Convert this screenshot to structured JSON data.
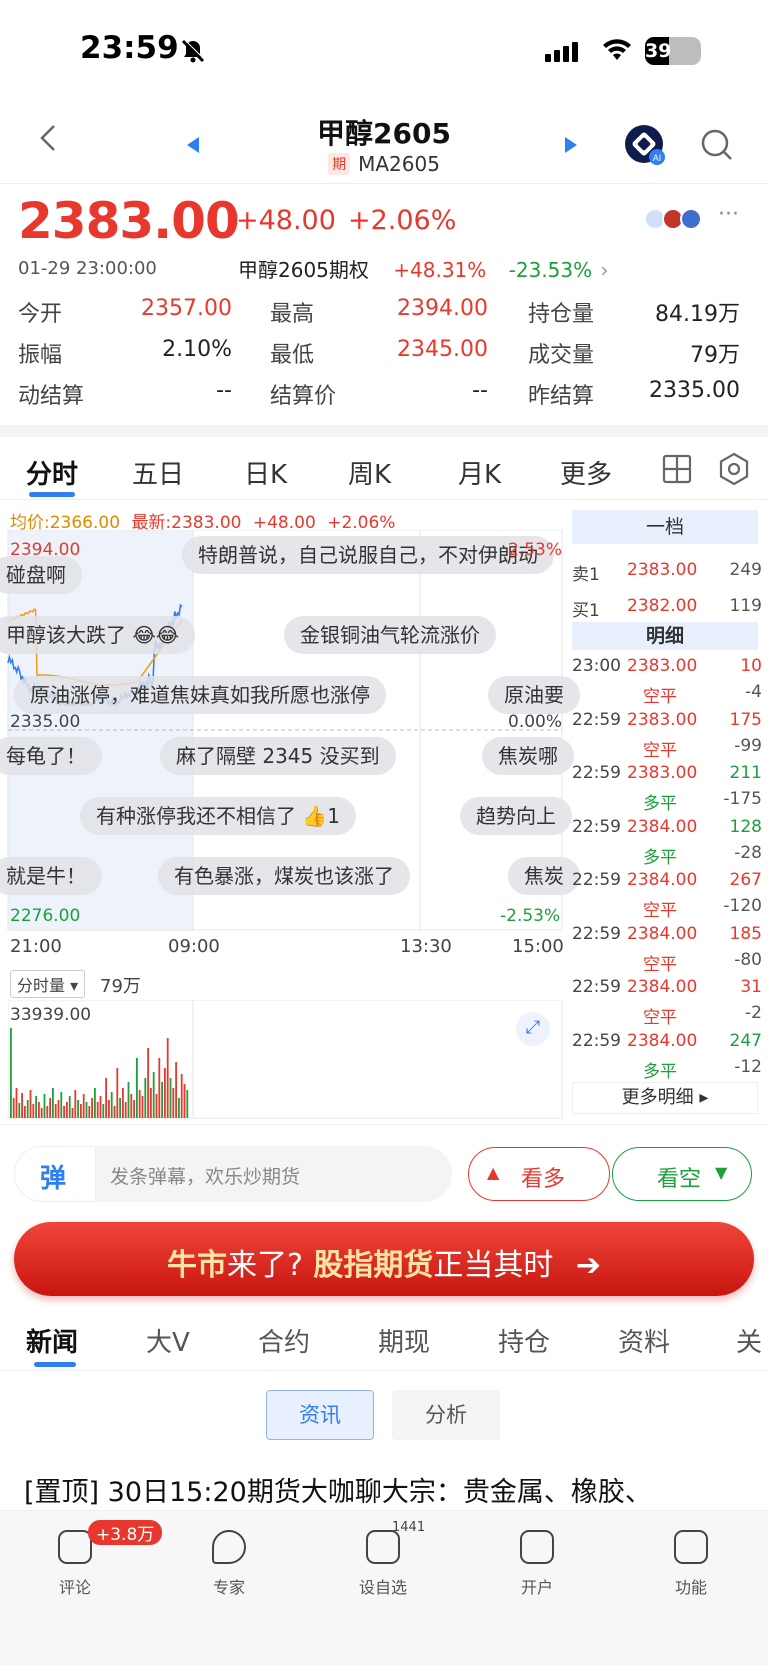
{
  "status": {
    "time": "23:59",
    "battery": "39"
  },
  "header": {
    "title": "甲醇2605",
    "badge": "期",
    "code": "MA2605"
  },
  "quote": {
    "price": "2383.00",
    "change": "+48.00",
    "pct": "+2.06%",
    "datetime": "01-29 23:00:00",
    "option_name": "甲醇2605期权",
    "option_up": "+48.31%",
    "option_down": "-23.53%"
  },
  "stats": [
    {
      "label": "今开",
      "value": "2357.00",
      "color": "red"
    },
    {
      "label": "最高",
      "value": "2394.00",
      "color": "red"
    },
    {
      "label": "持仓量",
      "value": "84.19万",
      "color": "black"
    },
    {
      "label": "振幅",
      "value": "2.10%",
      "color": "black"
    },
    {
      "label": "最低",
      "value": "2345.00",
      "color": "red"
    },
    {
      "label": "成交量",
      "value": "79万",
      "color": "black"
    },
    {
      "label": "动结算",
      "value": "--",
      "color": "black"
    },
    {
      "label": "结算价",
      "value": "--",
      "color": "black"
    },
    {
      "label": "昨结算",
      "value": "2335.00",
      "color": "black"
    }
  ],
  "tabs": [
    "分时",
    "五日",
    "日K",
    "周K",
    "月K",
    "更多"
  ],
  "legend": {
    "avg": "均价:2366.00",
    "latest": "最新:2383.00",
    "change": "+48.00",
    "pct": "+2.06%"
  },
  "chart_data": {
    "type": "line",
    "xticks": [
      "21:00",
      "09:00",
      "13:30",
      "15:00"
    ],
    "yticks_left": [
      "2394.00",
      "2335.00",
      "2276.00"
    ],
    "yticks_right": [
      "2.53%",
      "0.00%",
      "-2.53%"
    ],
    "volume_label": "分时量",
    "volume_total": "79万",
    "volume_max": "33939.00"
  },
  "danmu": [
    "碰盘啊",
    "特朗普说，自己说服自己，不对伊朗动",
    "甲醇该大跌了",
    "金银铜油气轮流涨价",
    "原油涨停，难道焦妹真如我所愿也涨停",
    "原油要",
    "每龟了！",
    "麻了隔壁 2345 没买到",
    "焦炭哪",
    "有种涨停我还不相信了",
    "1",
    "趋势向上",
    "就是牛！",
    "有色暴涨，煤炭也该涨了",
    "焦炭"
  ],
  "orderbook": {
    "level": "一档",
    "sell_label": "卖1",
    "sell_price": "2383.00",
    "sell_vol": "249",
    "buy_label": "买1",
    "buy_price": "2382.00",
    "buy_vol": "119",
    "detail_title": "明细",
    "more": "更多明细",
    "trades": [
      {
        "t": "23:00",
        "p": "2383.00",
        "v": "10",
        "type": "空平",
        "d": "-4"
      },
      {
        "t": "22:59",
        "p": "2383.00",
        "v": "175",
        "type": "空平",
        "d": "-99"
      },
      {
        "t": "22:59",
        "p": "2383.00",
        "v": "211",
        "type": "多平",
        "d": "-175"
      },
      {
        "t": "22:59",
        "p": "2384.00",
        "v": "128",
        "type": "多平",
        "d": "-28"
      },
      {
        "t": "22:59",
        "p": "2384.00",
        "v": "267",
        "type": "空平",
        "d": "-120"
      },
      {
        "t": "22:59",
        "p": "2384.00",
        "v": "185",
        "type": "空平",
        "d": "-80"
      },
      {
        "t": "22:59",
        "p": "2384.00",
        "v": "31",
        "type": "空平",
        "d": "-2"
      },
      {
        "t": "22:59",
        "p": "2384.00",
        "v": "247",
        "type": "多平",
        "d": "-12"
      }
    ]
  },
  "comment_bar": {
    "icon_text": "弹",
    "placeholder": "发条弹幕，欢乐炒期货",
    "bull": "看多",
    "bear": "看空"
  },
  "banner": {
    "p1": "牛市",
    "p2": "来了?",
    "p3": "股指期货",
    "p4": "正当其时"
  },
  "news_tabs": [
    "新闻",
    "大V",
    "合约",
    "期现",
    "持仓",
    "资料",
    "关"
  ],
  "news_sub": [
    "资讯",
    "分析"
  ],
  "news_headline": "[置顶] 30日15:20期货大咖聊大宗：贵金属、橡胶、",
  "bottom_nav": [
    {
      "label": "评论",
      "badge": "+3.8万"
    },
    {
      "label": "专家"
    },
    {
      "label": "设自选",
      "badge": "1441"
    },
    {
      "label": "开户"
    },
    {
      "label": "功能"
    }
  ]
}
